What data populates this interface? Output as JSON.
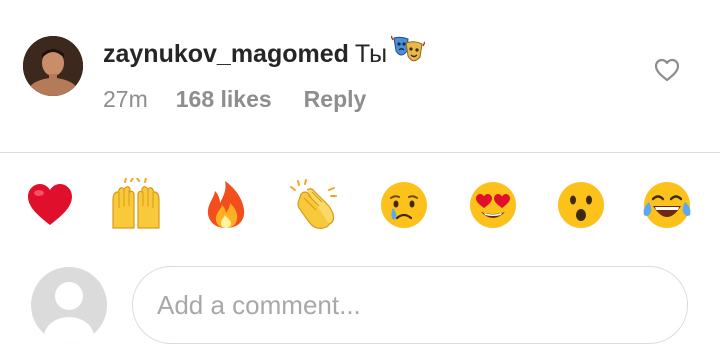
{
  "comment": {
    "username": "zaynukov_magomed",
    "text": "Ты",
    "text_icon": "performing-arts-masks-icon",
    "timestamp": "27m",
    "likes": "168 likes",
    "reply_label": "Reply"
  },
  "quick_reactions": [
    {
      "icon": "red-heart-icon"
    },
    {
      "icon": "raising-hands-icon"
    },
    {
      "icon": "fire-icon"
    },
    {
      "icon": "clapping-hands-icon"
    },
    {
      "icon": "crying-face-icon"
    },
    {
      "icon": "heart-eyes-face-icon"
    },
    {
      "icon": "surprised-face-icon"
    },
    {
      "icon": "tears-of-joy-face-icon"
    }
  ],
  "composer": {
    "placeholder": "Add a comment..."
  },
  "colors": {
    "text_primary": "#262626",
    "text_secondary": "#8e8e8e",
    "divider": "#dbdbdb",
    "placeholder": "#a8a8a8"
  }
}
